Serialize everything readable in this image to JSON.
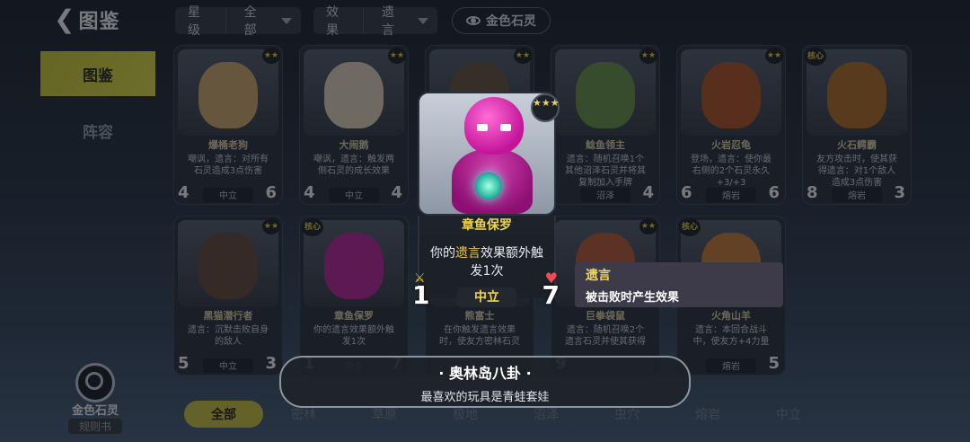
{
  "header": {
    "back_title": "图鉴"
  },
  "filters": [
    {
      "label": "星级",
      "value": "全部"
    },
    {
      "label": "效果",
      "value": "遗言"
    }
  ],
  "gold_toggle": {
    "label": "金色石灵",
    "icon": "eye-icon"
  },
  "nav": {
    "items": [
      "图鉴",
      "阵容"
    ],
    "active": "图鉴"
  },
  "rulebook": {
    "name": "金色石灵",
    "sub": "规则书"
  },
  "cards": [
    {
      "name": "爆桶老狗",
      "desc": "嘲讽，遗言：对所有石灵造成3点伤害",
      "race": "中立",
      "atk": "4",
      "hp": "6",
      "color": "#d9b074"
    },
    {
      "name": "大闹鹅",
      "desc": "嘲讽，遗言：触发两侧石灵的成长效果",
      "race": "中立",
      "atk": "4",
      "hp": "4",
      "color": "#e8dcc0"
    },
    {
      "name": "",
      "desc": "",
      "race": "",
      "atk": "",
      "hp": "",
      "color": "#6a5a40"
    },
    {
      "name": "鲶鱼领主",
      "desc": "遗言：随机召唤1个其他沼泽石灵并将其复制加入手牌",
      "race": "沼泽",
      "atk": "",
      "hp": "4",
      "color": "#6e9a4c"
    },
    {
      "name": "火岩忍龟",
      "desc": "登场，遗言：使你最右侧的2个石灵永久+3/+3",
      "race": "熔岩",
      "atk": "6",
      "hp": "6",
      "color": "#b85a2c"
    },
    {
      "name": "火石鳄霸",
      "desc": "友方攻击时，使其获得遗言：对1个敌人造成3点伤害",
      "race": "熔岩",
      "atk": "8",
      "hp": "3",
      "color": "#b8742c"
    },
    {
      "name": "黑猫潜行者",
      "desc": "遗言：沉默击败自身的敌人",
      "race": "中立",
      "atk": "5",
      "hp": "3",
      "color": "#6a4e3c"
    },
    {
      "name": "章鱼保罗",
      "desc": "你的遗言效果额外触发1次",
      "race": "中立",
      "atk": "1",
      "hp": "7",
      "color": "#c42aa0"
    },
    {
      "name": "熊富士",
      "desc": "在你触发遗言效果时，使友方密林石灵",
      "race": "",
      "atk": "",
      "hp": "",
      "color": "#7a5a3a"
    },
    {
      "name": "巨拳袋鼠",
      "desc": "遗言：随机召唤2个遗言石灵并使其获得",
      "race": "",
      "atk": "9",
      "hp": "",
      "color": "#c0603a"
    },
    {
      "name": "火角山羊",
      "desc": "遗言：本回合战斗中，使友方+4力量",
      "race": "熔岩",
      "atk": "",
      "hp": "5",
      "color": "#d0803a"
    }
  ],
  "card_labels": {
    "stars": "★★",
    "core": "核心"
  },
  "popup": {
    "name": "章鱼保罗",
    "desc_pre": "你的",
    "desc_hl": "遗言",
    "desc_post": "效果额外触发1次",
    "race": "中立",
    "atk": "1",
    "hp": "7",
    "stars": "★★★"
  },
  "tooltip": {
    "title": "遗言",
    "text": "被击败时产生效果"
  },
  "trivia": {
    "title": "· 奥林岛八卦 ·",
    "text": "最喜欢的玩具是青蛙套娃"
  },
  "tabs": {
    "items": [
      "全部",
      "密林",
      "草原",
      "极地",
      "沼泽",
      "虫穴",
      "熔岩",
      "中立"
    ],
    "active": "全部"
  }
}
